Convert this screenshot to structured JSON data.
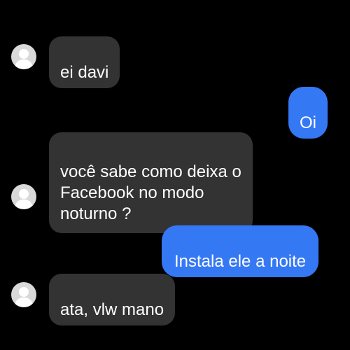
{
  "conversation": {
    "messages": [
      {
        "sender": "contact",
        "text": "ei davi"
      },
      {
        "sender": "me",
        "text": "Oi"
      },
      {
        "sender": "contact",
        "text": "você sabe como deixa o\nFacebook no modo\nnoturno ?"
      },
      {
        "sender": "me",
        "text": "Instala ele a noite"
      },
      {
        "sender": "contact",
        "text": "ata, vlw mano"
      }
    ],
    "avatar_icon": "default-profile-icon",
    "colors": {
      "background": "#000000",
      "incoming_bubble": "#333334",
      "outgoing_bubble": "#3578f4",
      "text": "#ffffff",
      "avatar": "#d9d9d9"
    }
  }
}
